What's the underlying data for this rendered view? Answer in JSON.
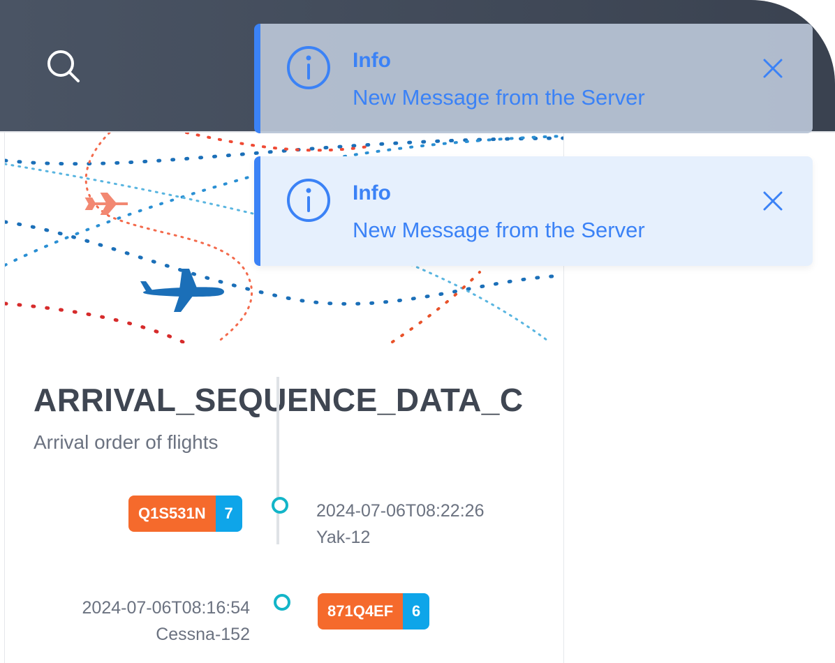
{
  "toasts": [
    {
      "title": "Info",
      "message": "New Message from the Server"
    },
    {
      "title": "Info",
      "message": "New Message from the Server"
    }
  ],
  "card": {
    "title": "ARRIVAL_SEQUENCE_DATA_C",
    "subtitle": "Arrival order of flights"
  },
  "timeline": [
    {
      "flight_id": "Q1S531N",
      "count": "7",
      "time": "2024-07-06T08:22:26",
      "aircraft": "Yak-12"
    },
    {
      "flight_id": "871Q4EF",
      "count": "6",
      "time": "2024-07-06T08:16:54",
      "aircraft": "Cessna-152"
    }
  ],
  "colors": {
    "accent": "#3b82f6",
    "tag_orange": "#f56a2c",
    "badge_blue": "#0ea5e9",
    "timeline_dot": "#13b5c8",
    "topbar": "#434c5a"
  },
  "icons": [
    "search-icon",
    "info-icon",
    "close-icon",
    "airplane-icon"
  ]
}
